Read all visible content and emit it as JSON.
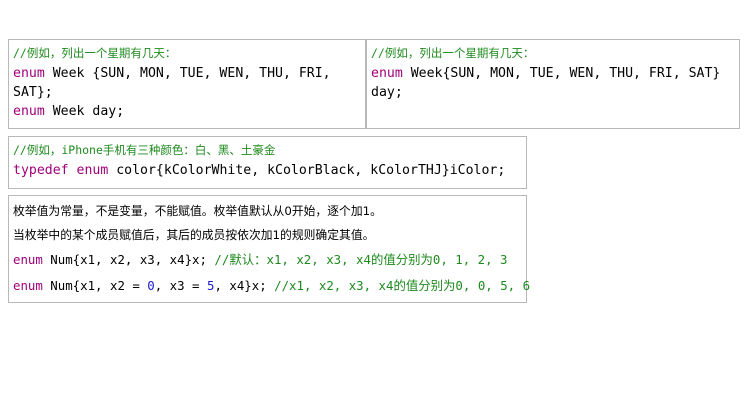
{
  "box1": {
    "comment": "//例如，列出一个星期有几天：",
    "line1_kw": "enum",
    "line1_rest": " Week {SUN, MON, TUE, WEN, THU, FRI,",
    "line2": "SAT};",
    "line3_kw": "enum",
    "line3_rest": " Week day;"
  },
  "box2": {
    "comment": "//例如，列出一个星期有几天：",
    "line1_kw": "enum",
    "line1_rest": " Week{SUN, MON, TUE, WEN, THU, FRI, SAT}",
    "line2": "day;"
  },
  "box3": {
    "comment": "//例如，iPhone手机有三种颜色：白、黑、土豪金",
    "kw1": "typedef",
    "kw2": "enum",
    "rest": " color{kColorWhite, kColorBlack, kColorTHJ}iColor;"
  },
  "box4": {
    "text1": "枚举值为常量，不是变量，不能赋值。枚举值默认从0开始，逐个加1。",
    "text2": "当枚举中的某个成员赋值后，其后的成员按依次加1的规则确定其值。",
    "code1_kw": "enum",
    "code1_rest": " Num{x1, x2, x3, x4}x; ",
    "code1_comment": "//默认：x1, x2, x3, x4的值分别为0, 1, 2, 3",
    "code2_kw": "enum",
    "code2_a": " Num{x1, x2 = ",
    "code2_n1": "0",
    "code2_b": ", x3 = ",
    "code2_n2": "5",
    "code2_c": ", x4}x; ",
    "code2_comment": "//x1, x2, x3, x4的值分别为0, 0, 5, 6"
  },
  "colors": {
    "comment": "#1e8a1e",
    "keyword": "#a0007a",
    "number": "#1a1ac8",
    "border": "#b8b8b8"
  }
}
